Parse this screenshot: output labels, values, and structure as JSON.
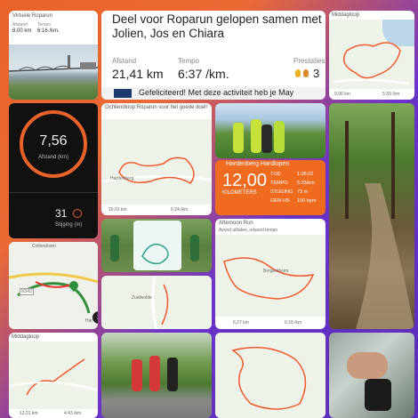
{
  "virtual_roparun": {
    "title": "Virtuele Roparun",
    "stats_labels": [
      "Afstand",
      "Tempo"
    ],
    "stats_values": [
      "8,00 km",
      "6:16 /km."
    ]
  },
  "main_card": {
    "title": "Deel voor Roparun gelopen samen met Jolien, Jos en Chiara",
    "distance_label": "Afstand",
    "distance_value": "21,41 km",
    "pace_label": "Tempo",
    "pace_value": "6:37 /km.",
    "prestaties_label": "Prestaties",
    "prestaties_count": "3",
    "banner_text": "Gefeliciteerd! Met deze activiteit heb je May"
  },
  "middagloop_top": {
    "title": "Middagloop",
    "values": [
      "9,96 km",
      "5:39 /km."
    ]
  },
  "watch": {
    "distance_value": "7,56",
    "distance_unit": "Afstand (km)",
    "climb_value": "31",
    "climb_label": "Stijging (m)"
  },
  "ochtendloop": {
    "title": "Ochtendloop Roparun voor het goede doel!",
    "place": "Hardenberg",
    "values": [
      "10,01 km",
      "6:24 /km."
    ]
  },
  "hardenberg_card": {
    "title": "Hardenberg Hardlopen",
    "big_value": "12,00",
    "big_unit": "KILOMETERS",
    "rows": [
      {
        "label": "TIJD",
        "value": "1:05:02"
      },
      {
        "label": "TEMPO",
        "value": "5:25/km"
      },
      {
        "label": "STIJGING",
        "value": "73 m"
      },
      {
        "label": "GEM HS",
        "value": "150 bpm"
      }
    ]
  },
  "map_coll": {
    "place": "Collendoorn",
    "road": "N343",
    "place2": "Har",
    "badge": "1"
  },
  "afternoon_run": {
    "title": "Afternoon Run",
    "subtitle": "Avond uitlaten, relaxed tempo",
    "place": "Bergentheim",
    "values": [
      "6,27 km",
      "6:18 /km."
    ]
  },
  "zuidwolde_map": {
    "place": "Zuidwolde"
  },
  "middagloop_bottom": {
    "title": "Middagloop",
    "values": [
      "12,01 km",
      "4:43 /km."
    ]
  },
  "colors": {
    "orange": "#e8622a",
    "purple": "#5b2fb3",
    "route": "#f2592a"
  }
}
